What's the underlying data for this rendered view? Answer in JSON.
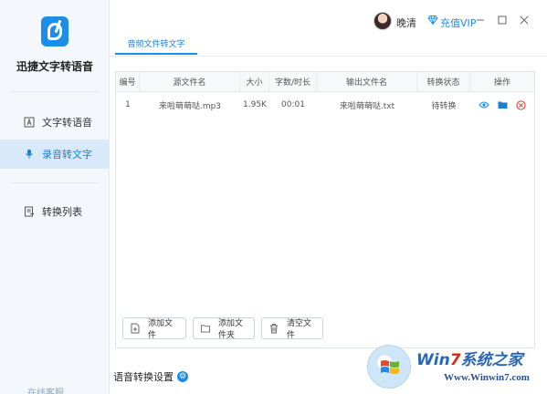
{
  "app": {
    "name": "迅捷文字转语音"
  },
  "sidebar": {
    "items": [
      {
        "label": "文字转语音",
        "icon": "text-document-icon"
      },
      {
        "label": "录音转文字",
        "icon": "microphone-icon",
        "active": true
      },
      {
        "label": "转换列表",
        "icon": "convert-list-icon"
      }
    ],
    "bottom_link": "在线客服"
  },
  "titlebar": {
    "username": "晚清",
    "vip_label": "充值VIP"
  },
  "tabs": [
    {
      "label": "音频文件转文字",
      "active": true
    }
  ],
  "table": {
    "headers": [
      "编号",
      "源文件名",
      "大小",
      "字数/时长",
      "输出文件名",
      "转换状态",
      "操作"
    ],
    "rows": [
      {
        "num": "1",
        "source": "来啦萌萌哒.mp3",
        "size": "1.95K",
        "duration": "00:01",
        "output": "来啦萌萌哒.txt",
        "status": "待转换"
      }
    ]
  },
  "buttons": {
    "add_file": "添加文件",
    "add_folder": "添加文件夹",
    "clear": "清空文件"
  },
  "settings_label": "语音转换设置",
  "watermark": {
    "brand_a": "Win",
    "brand_b": "7",
    "brand_c": "系统之家",
    "site": "Www.Winwin7.com"
  },
  "colors": {
    "accent": "#1c8ee8",
    "active_bg": "#d8e9f9",
    "danger": "#e0392b"
  }
}
